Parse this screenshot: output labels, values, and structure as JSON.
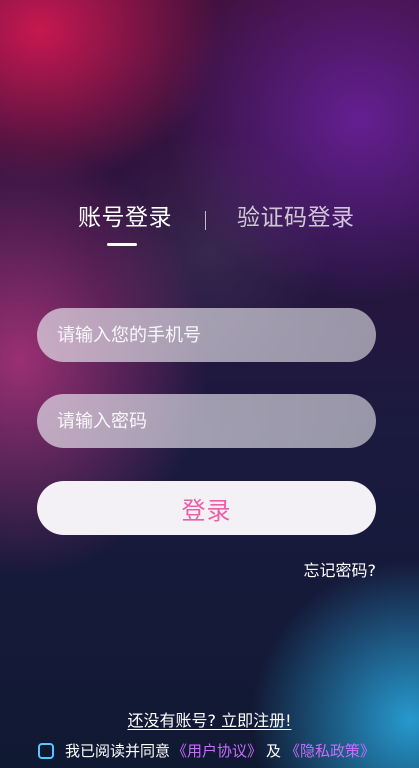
{
  "tabs": {
    "account_login": "账号登录",
    "divider": "|",
    "code_login": "验证码登录"
  },
  "form": {
    "phone_placeholder": "请输入您的手机号",
    "password_placeholder": "请输入密码",
    "login_label": "登录",
    "forgot_password": "忘记密码?"
  },
  "footer": {
    "register": "还没有账号? 立即注册!",
    "agree_text": "我已阅读并同意",
    "user_agreement": "《用户协议》",
    "and": "及",
    "privacy_policy": "《隐私政策》"
  },
  "colors": {
    "login_text": "#eb5fa6",
    "link_purple": "#c86cff",
    "checkbox_blue": "#56c7ff"
  }
}
